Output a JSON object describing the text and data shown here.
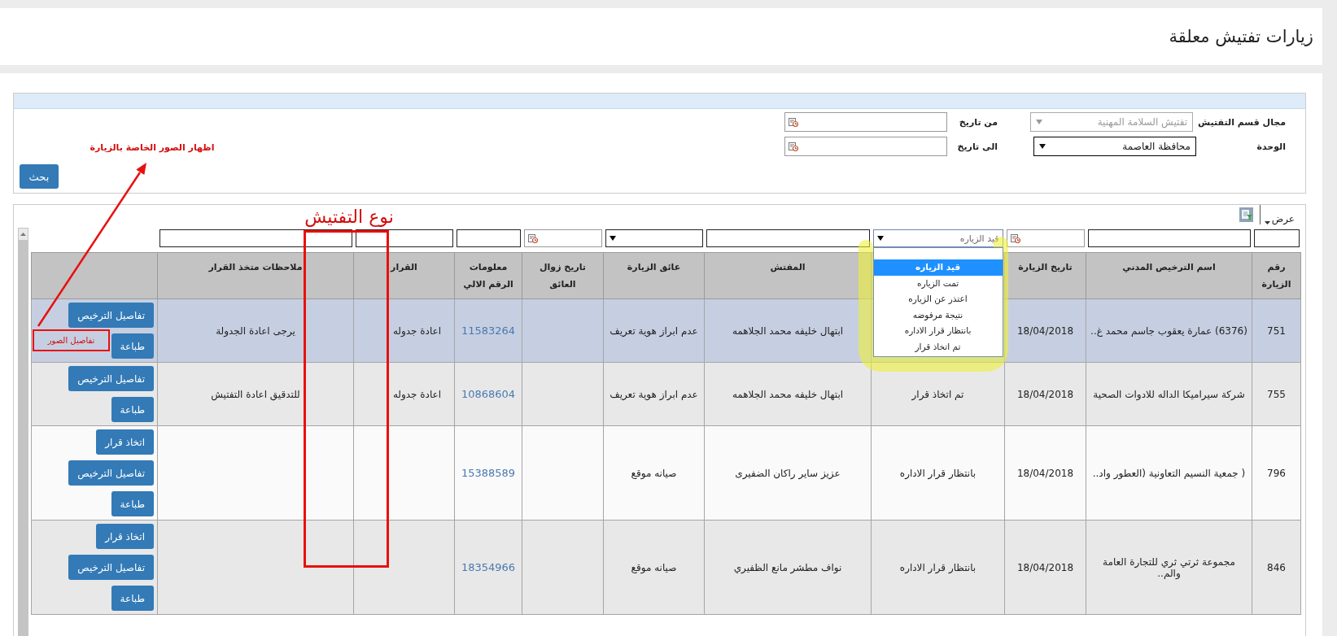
{
  "page_title": "زيارات تفتيش معلقة",
  "search_form": {
    "fields": [
      {
        "kind": "select",
        "label": "مجال قسم التفتيش",
        "value": "تفتيش السلامة المهنية",
        "disabled": true
      },
      {
        "kind": "date",
        "label": "من تاريخ"
      },
      {
        "kind": "select",
        "label": "الوحدة",
        "value": "محافظة العاصمة",
        "disabled": false
      },
      {
        "kind": "date",
        "label": "الى تاريخ"
      }
    ],
    "search_button": "بحث"
  },
  "grid": {
    "view_menu": "عرض",
    "columns": [
      {
        "label": "رقم الزيارة",
        "filter": {
          "kind": "text"
        },
        "kind": "text"
      },
      {
        "label": "اسم الترخيص المدني",
        "filter": {
          "kind": "text"
        },
        "kind": "text"
      },
      {
        "label": "تاريخ الزيارة",
        "filter": {
          "kind": "date"
        },
        "kind": "text"
      },
      {
        "filter": {
          "kind": "status"
        },
        "kind": "text"
      },
      {
        "label": "المفتش",
        "filter": {
          "kind": "text"
        },
        "kind": "text"
      },
      {
        "label": "عائق الزيارة",
        "filter": {
          "kind": "select"
        },
        "kind": "text"
      },
      {
        "label": "تاريخ زوال العائق",
        "filter": {
          "kind": "date"
        },
        "kind": "text"
      },
      {
        "label": "معلومات الرقم الالي",
        "filter": {
          "kind": "text"
        },
        "kind": "link"
      },
      {
        "label": "القرار",
        "filter": {
          "kind": "text"
        },
        "kind": "text"
      },
      {
        "label": "ملاحظات متخذ القرار",
        "filter": {
          "kind": "text"
        },
        "kind": "text"
      },
      {
        "kind": "actions"
      }
    ],
    "status_filter": {
      "value": "قيد الزياره",
      "open": true,
      "options": [
        {
          "label": "قيد الزياره",
          "selected": true
        },
        {
          "label": "تمت الزياره",
          "selected": false
        },
        {
          "label": "اعتذر عن الزياره",
          "selected": false
        },
        {
          "label": "نتيجة مرفوضه",
          "selected": false
        },
        {
          "label": "بانتظار قرار الاداره",
          "selected": false
        },
        {
          "label": "تم اتخاذ قرار",
          "selected": false
        }
      ]
    },
    "rows": [
      {
        "selected": true,
        "cells": [
          "751",
          "(6376) عمارة يعقوب جاسم محمد غ..",
          "18/04/2018",
          null,
          "ابتهال خليفه محمد الجلاهمه",
          "عدم ابراز هوية تعريف",
          null,
          "11583264",
          "اعادة جدوله",
          "يرجى اعادة الجدولة",
          null
        ],
        "actions": [
          "تفاصيل الترخيص",
          "طباعة"
        ]
      },
      {
        "selected": false,
        "cells": [
          "755",
          "شركة سيراميكا الداله للادوات الصحية",
          "18/04/2018",
          "تم اتخاذ قرار",
          "ابتهال خليفه محمد الجلاهمه",
          "عدم ابراز هوية تعريف",
          null,
          "10868604",
          "اعادة جدوله",
          "للتدقيق اعادة التفتيش",
          null
        ],
        "actions": [
          "تفاصيل الترخيص",
          "طباعة"
        ]
      },
      {
        "selected": false,
        "cells": [
          "796",
          "( جمعية النسيم التعاونية (العطور واد..",
          "18/04/2018",
          "بانتظار قرار الاداره",
          "عزيز ساير راكان الضفيرى",
          "صيانه موقع",
          null,
          "15388589",
          null,
          null,
          null
        ],
        "actions": [
          "اتخاذ قرار",
          "تفاصيل الترخيص",
          "طباعة"
        ]
      },
      {
        "selected": false,
        "cells": [
          "846",
          "مجموعة ثرتي ثري للتجارة العامة والم..",
          "18/04/2018",
          "بانتظار قرار الاداره",
          "نواف مطشر مانع الظفيري",
          "صيانه موقع",
          null,
          "18354966",
          null,
          null,
          null
        ],
        "actions": [
          "اتخاذ قرار",
          "تفاصيل الترخيص",
          "طباعة"
        ]
      }
    ]
  },
  "annotations": [
    {
      "kind": "label",
      "text": "نوع التفتيش"
    },
    {
      "kind": "frame"
    },
    {
      "kind": "arrow"
    },
    {
      "kind": "label",
      "text": "اظهار الصور الخاصة بالزيارة"
    },
    {
      "kind": "boxed_label",
      "text": "تفاصيل الصور"
    },
    {
      "kind": "highlight"
    }
  ]
}
